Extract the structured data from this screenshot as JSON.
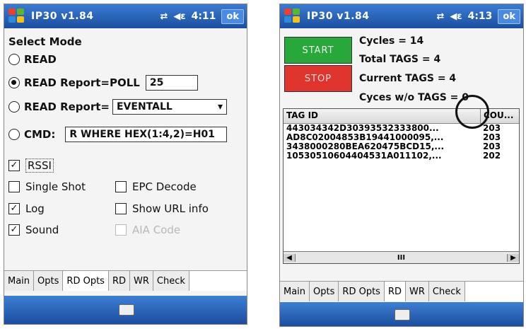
{
  "left": {
    "title": "IP30 v1.84",
    "time": "4:11",
    "ok": "ok",
    "select_mode": "Select Mode",
    "read": "READ",
    "read_report_poll": "READ Report=POLL",
    "poll_value": "25",
    "read_report": "READ Report=",
    "event_value": "EVENTALL",
    "cmd": "CMD:",
    "cmd_value": "R WHERE HEX(1:4,2)=H01",
    "rssi": "RSSI",
    "single_shot": "Single Shot",
    "epc_decode": "EPC Decode",
    "log": "Log",
    "show_url": "Show URL info",
    "sound": "Sound",
    "aia_code": "AIA Code",
    "tabs": [
      "Main",
      "Opts",
      "RD Opts",
      "RD",
      "WR",
      "Check"
    ]
  },
  "right": {
    "title": "IP30 v1.84",
    "time": "4:13",
    "ok": "ok",
    "start": "START",
    "stop": "STOP",
    "cycles": "Cycles = 14",
    "total_tags": "Total TAGS = 4",
    "current_tags": "Current TAGS = 4",
    "cycles_wo": "Cyces w/o TAGS = 0",
    "col_tag": "TAG ID",
    "col_count": "COU...",
    "rows": [
      {
        "tag": "443034342D30393532333800...",
        "count": "203"
      },
      {
        "tag": "AD8C02004853B19441000095,...",
        "count": "203"
      },
      {
        "tag": "3438000280BEA620475BCD15,...",
        "count": "203"
      },
      {
        "tag": "10530510604404531A011102,...",
        "count": "202"
      }
    ],
    "scroll_thumb": "III",
    "tabs": [
      "Main",
      "Opts",
      "RD Opts",
      "RD",
      "WR",
      "Check"
    ]
  },
  "icons": [
    "windows-start-icon",
    "connectivity-icon",
    "speaker-icon",
    "keyboard-icon"
  ]
}
